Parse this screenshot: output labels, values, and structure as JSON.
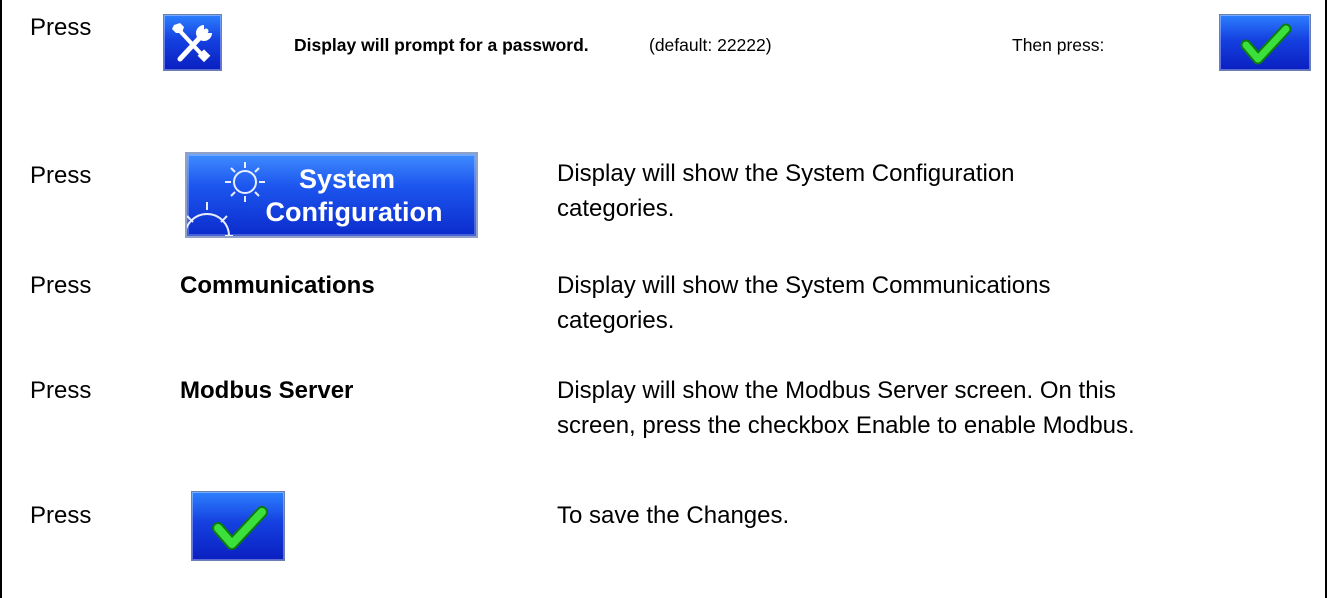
{
  "press_label": "Press",
  "row1": {
    "tools_icon": "tools-icon",
    "prompt_bold": "Display will prompt for a password.",
    "prompt_default": "(default: 22222)",
    "then_press": "Then press:",
    "check_icon": "checkmark-icon"
  },
  "row2": {
    "button_line1": "System",
    "button_line2": "Configuration",
    "gear_icon": "gear-icon",
    "desc_line1": "Display will show the System Configuration",
    "desc_line2": "categories."
  },
  "row3": {
    "item": "Communications",
    "desc_line1": "Display will show the System Communications",
    "desc_line2": "categories."
  },
  "row4": {
    "item": "Modbus Server",
    "desc_line1": "Display will show the Modbus Server screen.  On this",
    "desc_line2": "screen, press the checkbox Enable to enable Modbus."
  },
  "row5": {
    "check_icon": "checkmark-icon",
    "desc": "To save the Changes."
  },
  "colors": {
    "button_blue": "#1540e0",
    "check_green": "#2ecc2e",
    "button_text": "#ffffff"
  }
}
